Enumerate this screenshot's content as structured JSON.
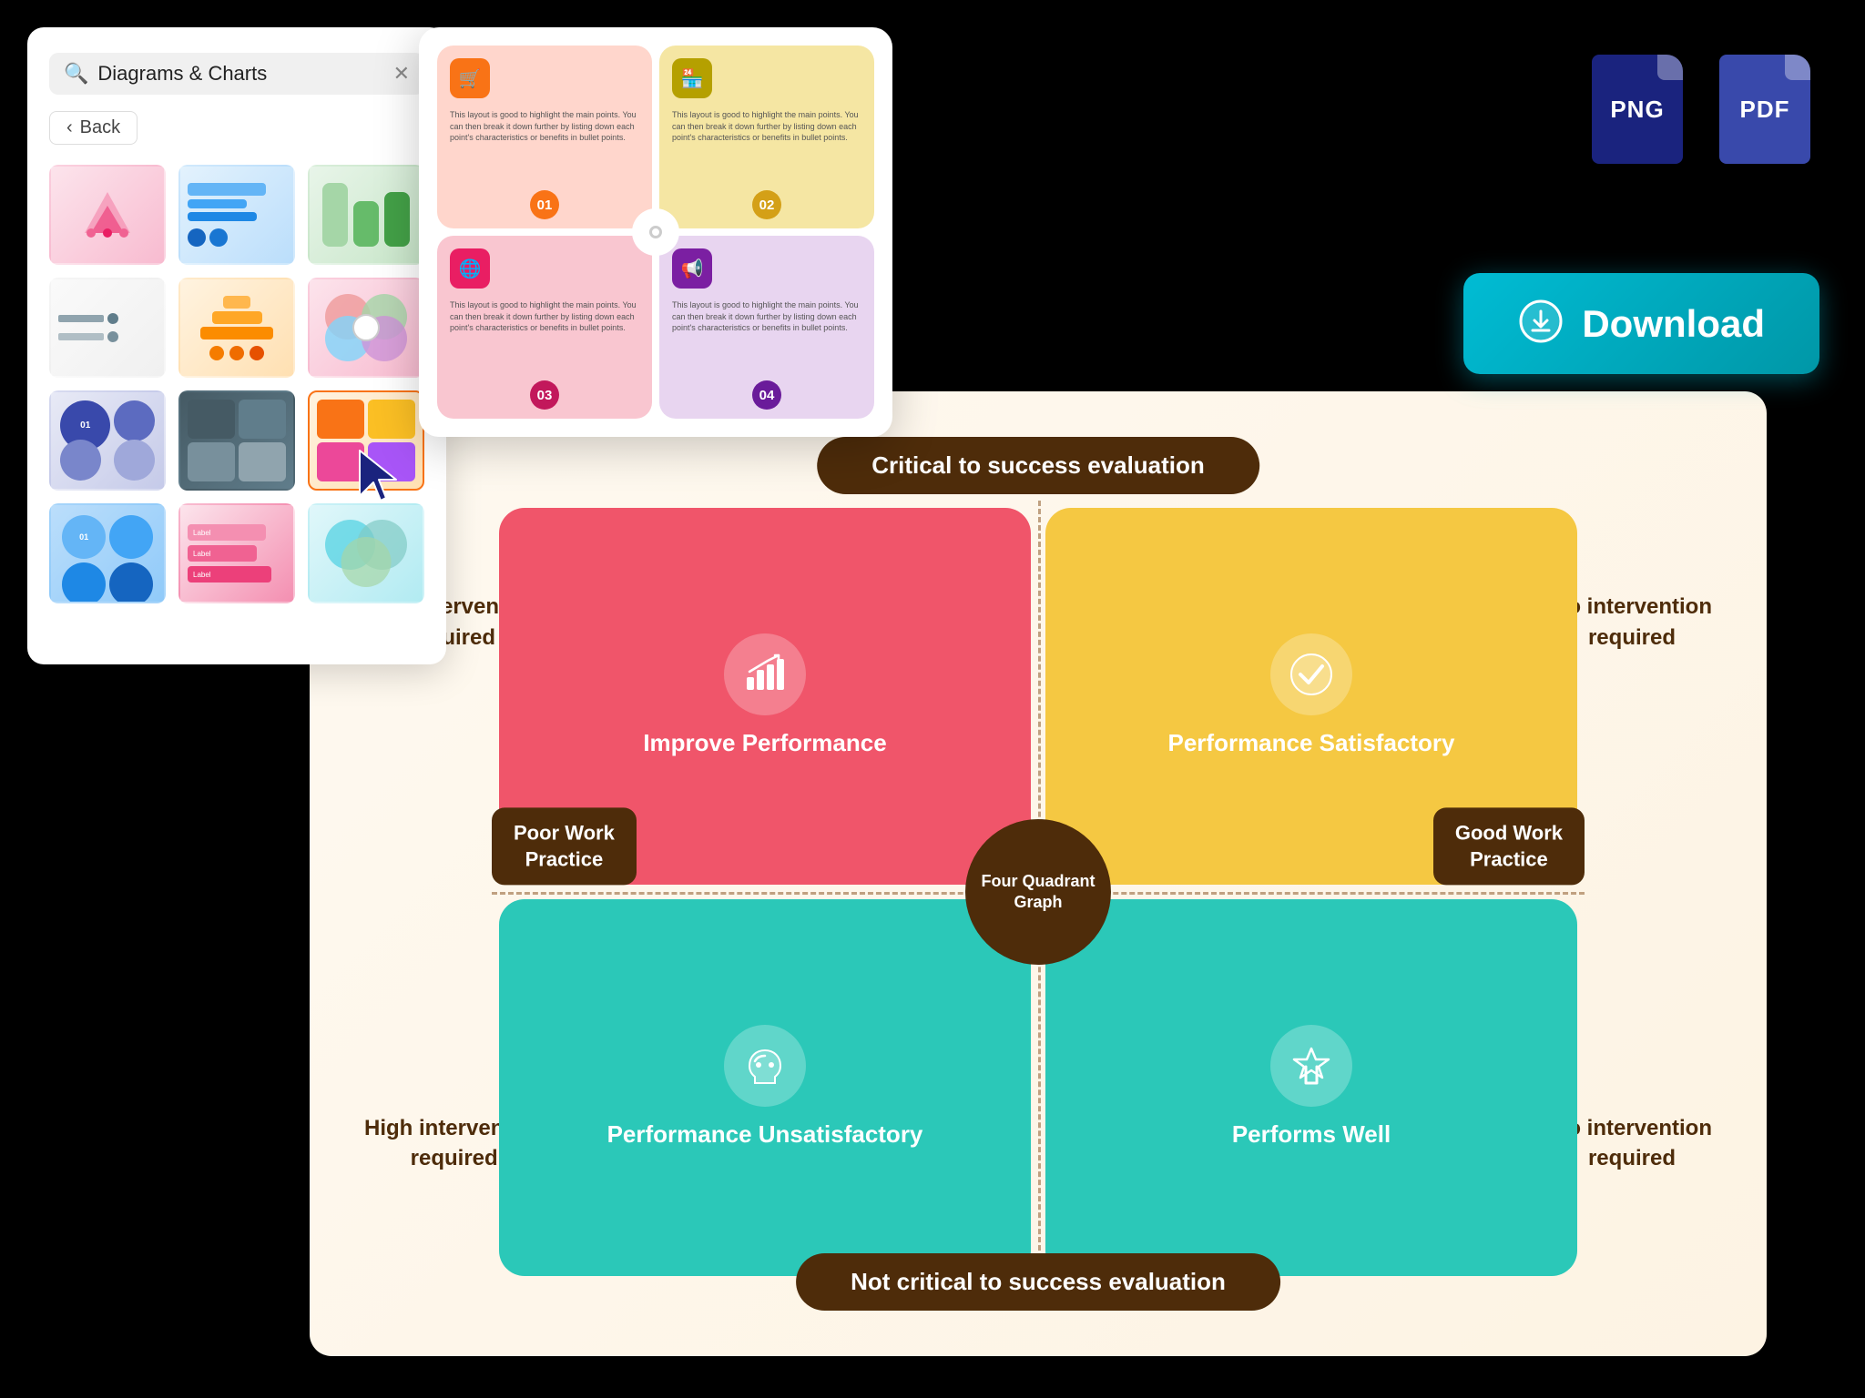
{
  "sidebar": {
    "search_placeholder": "Diagrams & Charts",
    "search_value": "Diagrams & Charts",
    "back_label": "Back",
    "close_label": "✕"
  },
  "preview": {
    "quadrants": [
      {
        "num": "01",
        "text": "This layout is good to highlight the main points. You can then break it down further by listing down each point's characteristics or benefits in bullet points."
      },
      {
        "num": "02",
        "text": "This layout is good to highlight the main points. You can then break it down further by listing down each point's characteristics or benefits in bullet points."
      },
      {
        "num": "03",
        "text": "This layout is good to highlight the main points. You can then break it down further by listing down each point's characteristics or benefits in bullet points."
      },
      {
        "num": "04",
        "text": "This layout is good to highlight the main points. You can then break it down further by listing down each point's characteristics or benefits in bullet points."
      }
    ]
  },
  "file_icons": {
    "png_label": "PNG",
    "pdf_label": "PDF"
  },
  "download": {
    "label": "Download"
  },
  "quadrant_graph": {
    "title_top": "Critical to success evaluation",
    "title_bottom": "Not critical to success evaluation",
    "label_left_top": "Low intervention\nrequired",
    "label_left_bottom": "High intervention\nrequired",
    "label_right_top": "No intervention\nrequired",
    "label_right_bottom": "No intervention\nrequired",
    "center_label": "Four\nQuadrant\nGraph",
    "label_poor": "Poor Work\nPractice",
    "label_good": "Good Work\nPractice",
    "cells": [
      {
        "id": "tl",
        "label": "Improve\nPerformance",
        "icon": "📈"
      },
      {
        "id": "tr",
        "label": "Performance\nSatisfactory",
        "icon": "✅"
      },
      {
        "id": "bl",
        "label": "Performance\nUnsatisfactory",
        "icon": "👎"
      },
      {
        "id": "br",
        "label": "Performs\nWell",
        "icon": "🏆"
      }
    ]
  },
  "colors": {
    "sidebar_bg": "#ffffff",
    "download_bg": "#00bcd4",
    "quadrant_graph_bg": "#fef9f0",
    "center_circle_bg": "#4e2c0a",
    "title_bar_bg": "#4e2c0a",
    "cell_tl": "#f0556a",
    "cell_tr": "#f5c842",
    "cell_bl": "#2bc8b8",
    "cell_br": "#2bc8b8"
  }
}
